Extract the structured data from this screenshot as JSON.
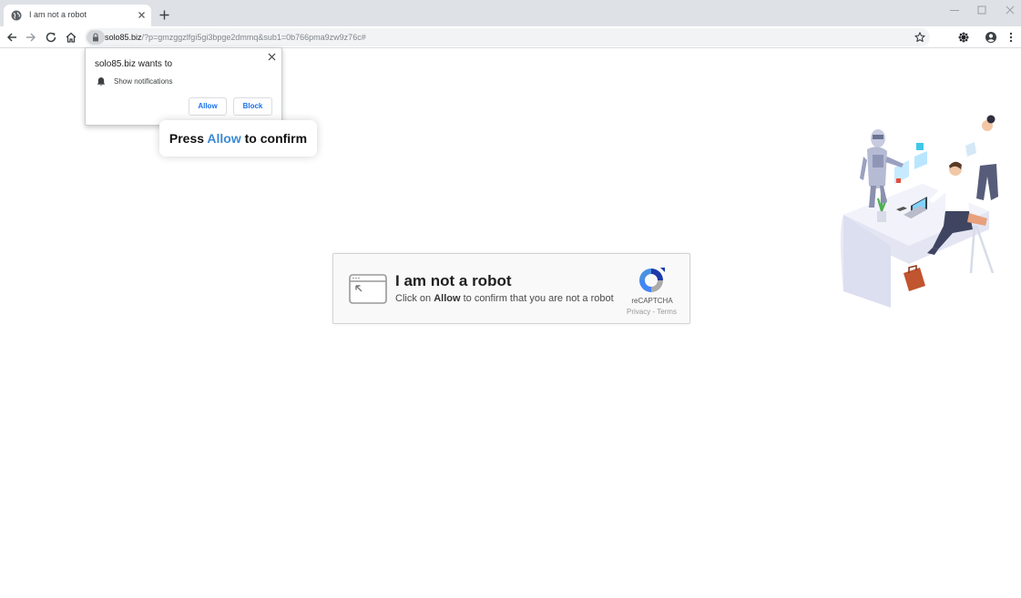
{
  "browser": {
    "tab": {
      "title": "I am not a robot"
    },
    "url": {
      "host": "solo85.biz",
      "path": "/?p=gmzggzlfgi5gi3bpge2dmmq&sub1=0b766pma9zw9z76c#"
    }
  },
  "permission_popup": {
    "title": "solo85.biz wants to",
    "permission": "Show notifications",
    "allow_label": "Allow",
    "block_label": "Block"
  },
  "bubble": {
    "prefix": "Press ",
    "highlight": "Allow",
    "suffix": " to confirm",
    "highlight_color": "#3b8ad6"
  },
  "captcha": {
    "title": "I am not a robot",
    "sub_prefix": "Click on ",
    "sub_bold": "Allow",
    "sub_suffix": " to confirm that you are not a robot",
    "brand": "reCAPTCHA",
    "links": "Privacy - Terms"
  },
  "icons": {
    "tab_favicon": "globe-icon",
    "back": "arrow-left-icon",
    "forward": "arrow-right-icon",
    "reload": "reload-icon",
    "home": "home-icon",
    "lock": "lock-icon",
    "bookmark": "star-icon",
    "extension": "extension-icon",
    "profile": "account-circle-icon",
    "menu": "kebab-menu-icon",
    "notification": "bell-icon"
  },
  "colors": {
    "accent_blue": "#1a73e8",
    "recaptcha_blue": "#1c3aa9",
    "tabstrip": "#dee1e6"
  }
}
